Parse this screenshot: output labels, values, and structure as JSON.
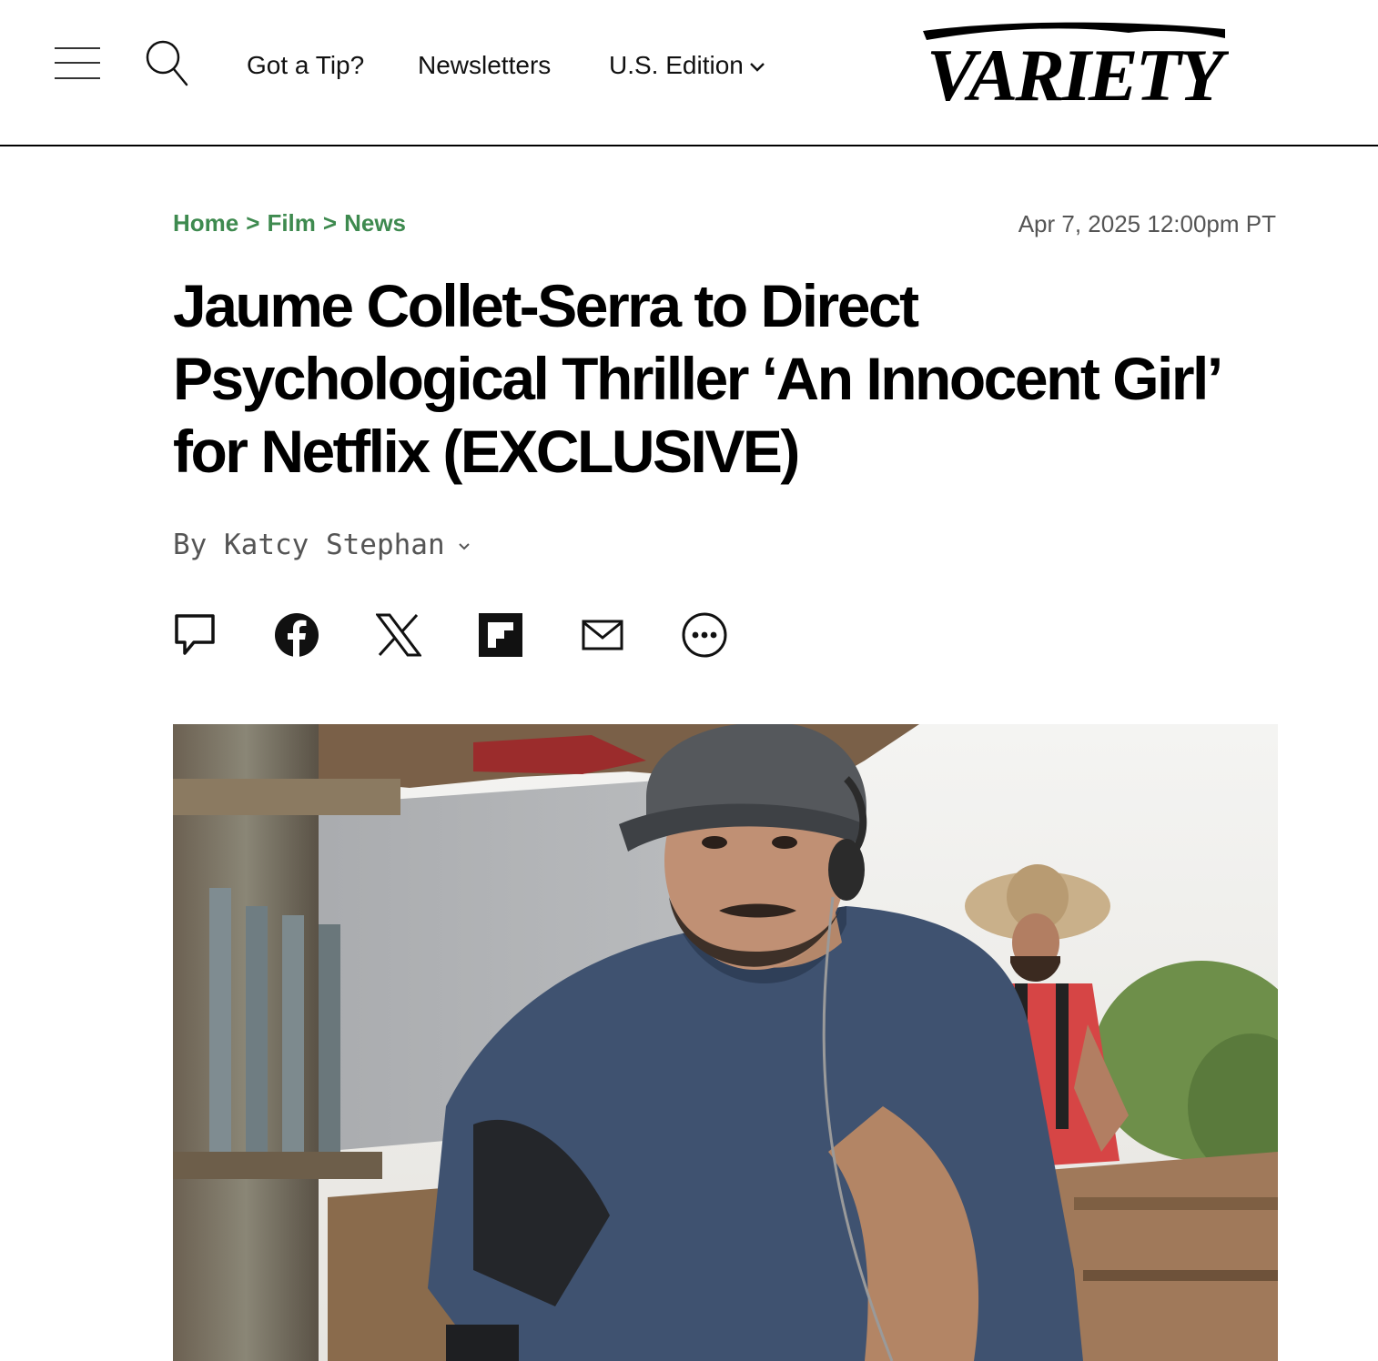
{
  "header": {
    "menu_icon": "hamburger-menu-icon",
    "search_icon": "search-icon",
    "nav": {
      "tip": "Got a Tip?",
      "newsletters": "Newsletters",
      "edition": "U.S. Edition"
    },
    "edition_icon": "chevron-down-icon",
    "logo_text": "VARIETY"
  },
  "article": {
    "breadcrumb": {
      "home": "Home",
      "separator": ">",
      "film": "Film",
      "news": "News"
    },
    "timestamp": "Apr 7, 2025 12:00pm PT",
    "headline": "Jaume Collet-Serra to Direct Psychological Thriller ‘An Innocent Girl’ for Netflix (EXCLUSIVE)",
    "byline": {
      "prefix": "By",
      "author": "Katcy Stephan"
    },
    "share_icons": [
      "comment-icon",
      "facebook-icon",
      "x-icon",
      "flipboard-icon",
      "email-icon",
      "more-icon"
    ]
  },
  "colors": {
    "breadcrumb": "#3e8a4f",
    "text": "#000000",
    "muted": "#555555"
  }
}
